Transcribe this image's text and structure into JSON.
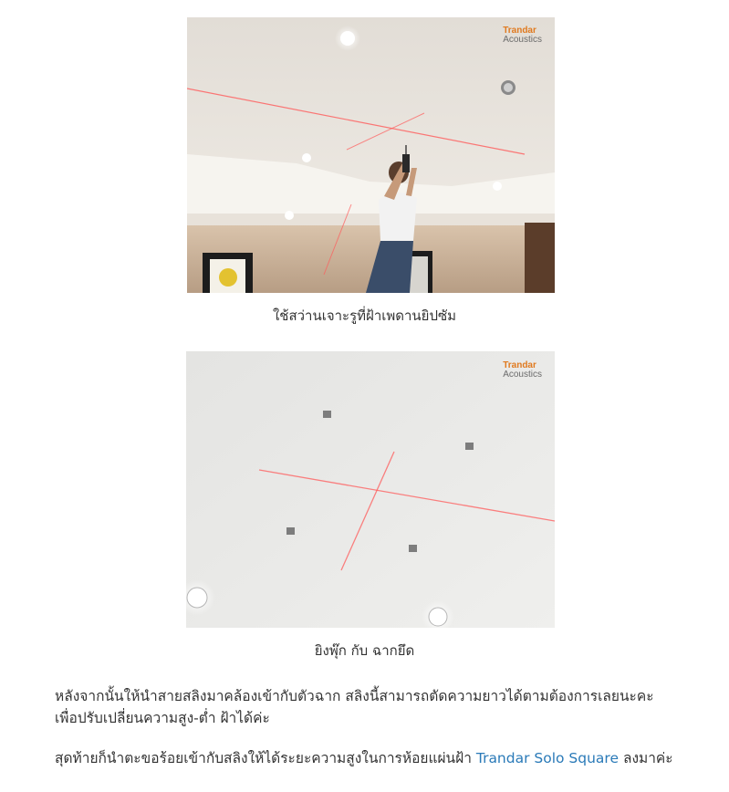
{
  "figures": [
    {
      "caption": "ใช้สว่านเจาะรูที่ฝ้าเพดานยิปซัม",
      "watermark": {
        "line1": "Trandar",
        "line2": "Acoustics"
      },
      "colors": {
        "ceiling": "#e9e5df",
        "wall": "#c9b19a",
        "laser": "#ff4b4b",
        "shirt": "#f2f2f2",
        "jeans": "#3a4d69"
      }
    },
    {
      "caption": "ยิงพุ๊ก กับ ฉากยึด",
      "watermark": {
        "line1": "Trandar",
        "line2": "Acoustics"
      },
      "colors": {
        "ceiling": "#e8e8e6",
        "laser": "#ff5a5a"
      }
    }
  ],
  "paragraph1": "หลังจากนั้นให้นำสายสลิงมาคล้องเข้ากับตัวฉาก สลิงนี้สามารถตัดความยาวได้ตามต้องการเลยนะคะ เพื่อปรับเปลี่ยนความสูง-ต่ำ ฝ้าได้ค่ะ",
  "paragraph2": {
    "before": "สุดท้ายก็นำตะขอร้อยเข้ากับสลิงให้ได้ระยะความสูงในการห้อยแผ่นฝ้า ",
    "link": "Trandar Solo Square",
    "after": " ลงมาค่ะ"
  }
}
